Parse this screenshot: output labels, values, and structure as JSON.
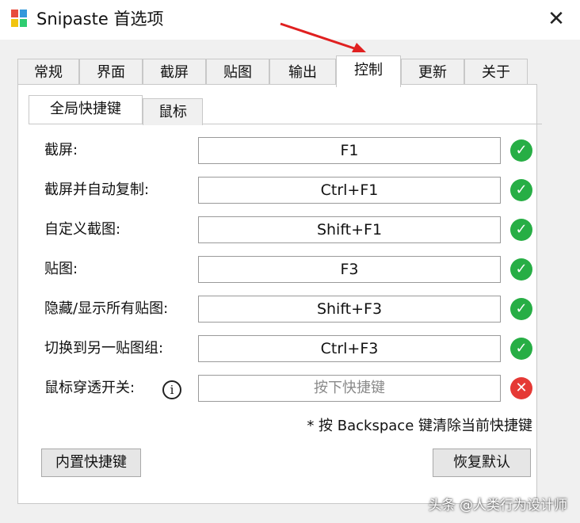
{
  "window": {
    "title": "Snipaste 首选项",
    "close_symbol": "✕"
  },
  "tabs": [
    "常规",
    "界面",
    "截屏",
    "贴图",
    "输出",
    "控制",
    "更新",
    "关于"
  ],
  "active_tab": "控制",
  "subtabs": [
    "全局快捷键",
    "鼠标"
  ],
  "active_subtab": "全局快捷键",
  "hotkeys": [
    {
      "label": "截屏:",
      "value": "F1",
      "status": "ok"
    },
    {
      "label": "截屏并自动复制:",
      "value": "Ctrl+F1",
      "status": "ok"
    },
    {
      "label": "自定义截图:",
      "value": "Shift+F1",
      "status": "ok"
    },
    {
      "label": "贴图:",
      "value": "F3",
      "status": "ok"
    },
    {
      "label": "隐藏/显示所有贴图:",
      "value": "Shift+F3",
      "status": "ok"
    },
    {
      "label": "切换到另一贴图组:",
      "value": "Ctrl+F3",
      "status": "ok"
    },
    {
      "label": "鼠标穿透开关:",
      "value": "",
      "placeholder": "按下快捷键",
      "status": "error"
    }
  ],
  "status_glyphs": {
    "ok": "✓",
    "error": "✕"
  },
  "info_glyph": "i",
  "note": "* 按 Backspace 键清除当前快捷键",
  "buttons": {
    "builtin": "内置快捷键",
    "restore": "恢复默认"
  },
  "watermark": "头条 @人类行为设计师",
  "colors": {
    "ok": "#27ae45",
    "error": "#e53935",
    "annotation_arrow": "#e02020"
  }
}
